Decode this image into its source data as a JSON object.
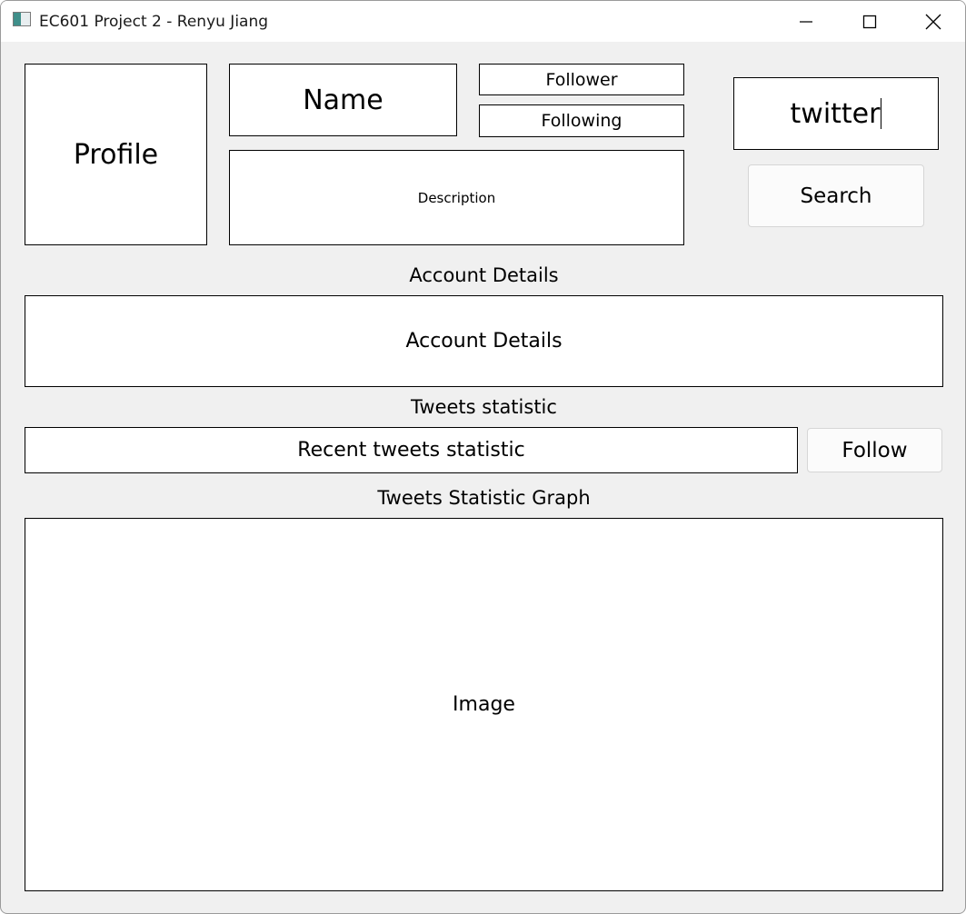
{
  "window": {
    "title": "EC601 Project 2 - Renyu Jiang"
  },
  "titlebar_icons": {
    "app": "app-icon",
    "minimize": "minimize-icon",
    "maximize": "maximize-icon",
    "close": "close-icon"
  },
  "profile": {
    "image_label": "Profile",
    "name": "Name",
    "follower": "Follower",
    "following": "Following",
    "description": "Description"
  },
  "search": {
    "query": "twitter",
    "button_label": "Search"
  },
  "account": {
    "heading": "Account Details",
    "details": "Account Details"
  },
  "tweets": {
    "heading": "Tweets statistic",
    "recent_statistic": "Recent tweets statistic",
    "follow_button": "Follow"
  },
  "graph": {
    "heading": "Tweets Statistic Graph",
    "image_label": "Image"
  }
}
